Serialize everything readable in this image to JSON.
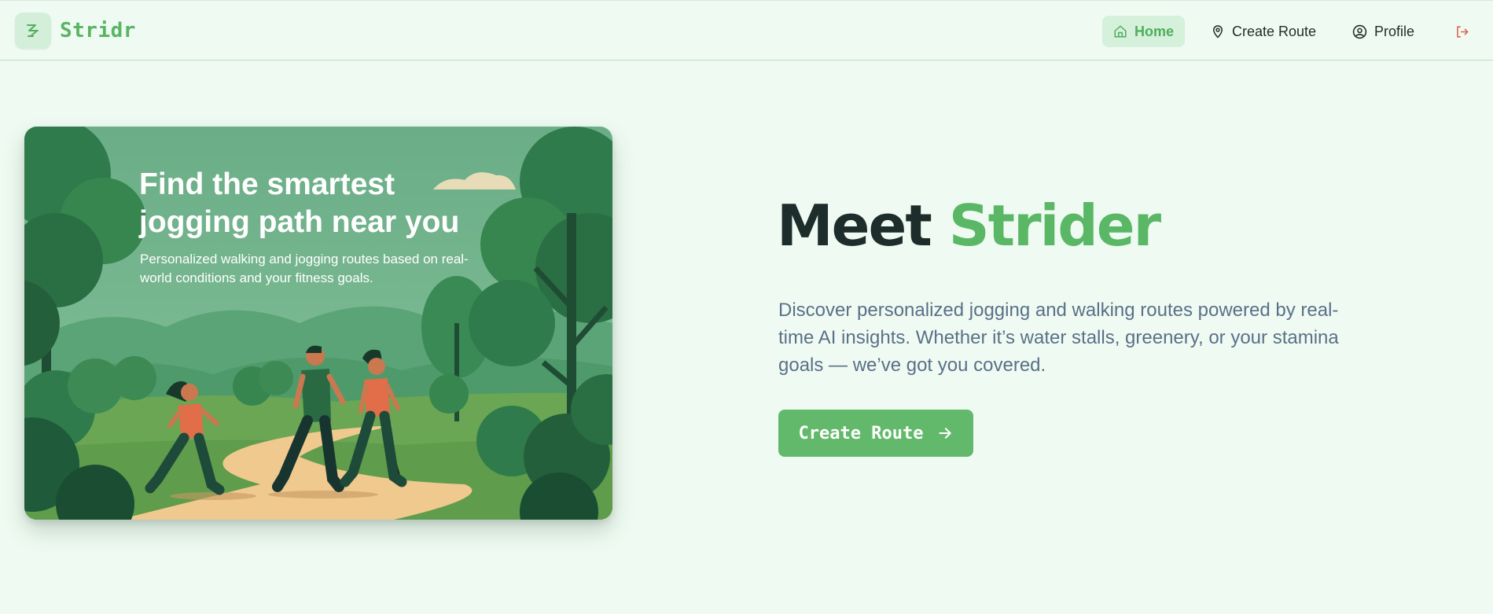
{
  "app": {
    "name": "Stridr",
    "logo_icon": "stride-bolt-icon"
  },
  "nav": {
    "items": [
      {
        "label": "Home",
        "icon": "home-icon",
        "active": true
      },
      {
        "label": "Create Route",
        "icon": "map-pin-icon",
        "active": false
      },
      {
        "label": "Profile",
        "icon": "user-circle-icon",
        "active": false
      }
    ],
    "logout_icon": "logout-icon"
  },
  "hero_card": {
    "title": "Find the smartest jogging path near you",
    "subtitle": "Personalized walking and jogging routes based on real-world conditions and your fitness goals."
  },
  "hero": {
    "title_prefix": "Meet ",
    "title_accent": "Strider",
    "description": "Discover personalized jogging and walking routes powered by real-time AI insights. Whether it’s water stalls, greenery, or your stamina goals — we’ve got you covered.",
    "cta_label": "Create Route",
    "cta_icon": "arrow-right-icon"
  },
  "colors": {
    "accent": "#5ab766",
    "background": "#effbf2",
    "heading": "#1d2d2b",
    "body_text": "#5a7088",
    "logout": "#e0604a"
  }
}
